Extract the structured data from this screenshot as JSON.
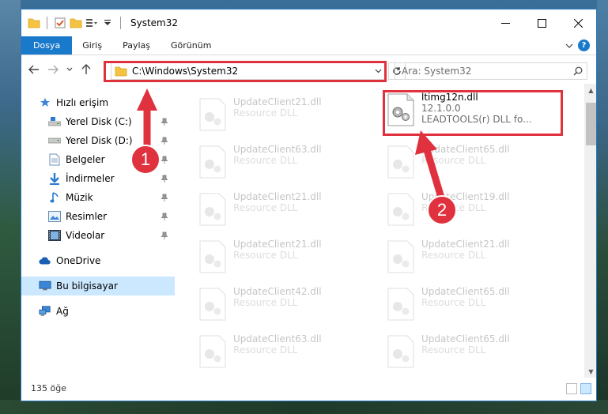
{
  "window": {
    "title": "System32"
  },
  "ribbon": {
    "tabs": [
      "Dosya",
      "Giriş",
      "Paylaş",
      "Görünüm"
    ]
  },
  "address": {
    "path": "C:\\Windows\\System32"
  },
  "search": {
    "placeholder": "Ara: System32"
  },
  "sidebar": {
    "quick_access": "Hızlı erişim",
    "items": [
      "Yerel Disk (C:)",
      "Yerel Disk (D:)",
      "Belgeler",
      "İndirmeler",
      "Müzik",
      "Resimler",
      "Videolar"
    ],
    "onedrive": "OneDrive",
    "this_pc": "Bu bilgisayar",
    "network": "Ağ"
  },
  "files": {
    "highlighted": {
      "name": "ltimg12n.dll",
      "version": "12.1.0.0",
      "description": "LEADTOOLS(r) DLL fo..."
    },
    "left_column": [
      {
        "name": "UpdateClient21.dll",
        "type": "Resource DLL"
      },
      {
        "name": "UpdateClient63.dll",
        "type": "Resource DLL"
      },
      {
        "name": "UpdateClient21.dll",
        "type": "Resource DLL"
      },
      {
        "name": "UpdateClient21.dll",
        "type": "Resource DLL"
      },
      {
        "name": "UpdateClient42.dll",
        "type": "Resource DLL"
      },
      {
        "name": "UpdateClient63.dll",
        "type": "Resource DLL"
      }
    ],
    "right_column": [
      {
        "name": "UpdateClient65.dll",
        "type": "Resource DLL"
      },
      {
        "name": "UpdateClient19.dll",
        "type": "Resource DLL"
      },
      {
        "name": "UpdateClient21.dll",
        "type": "Resource DLL"
      },
      {
        "name": "UpdateClient65.dll",
        "type": "Resource DLL"
      },
      {
        "name": "UpdateClient65.dll",
        "type": "Resource DLL"
      }
    ]
  },
  "status": {
    "count": "135 öğe"
  },
  "annotations": {
    "step1": "1",
    "step2": "2"
  },
  "colors": {
    "accent": "#1979ca",
    "annotation": "#e0323e",
    "selected": "#cce8ff"
  }
}
